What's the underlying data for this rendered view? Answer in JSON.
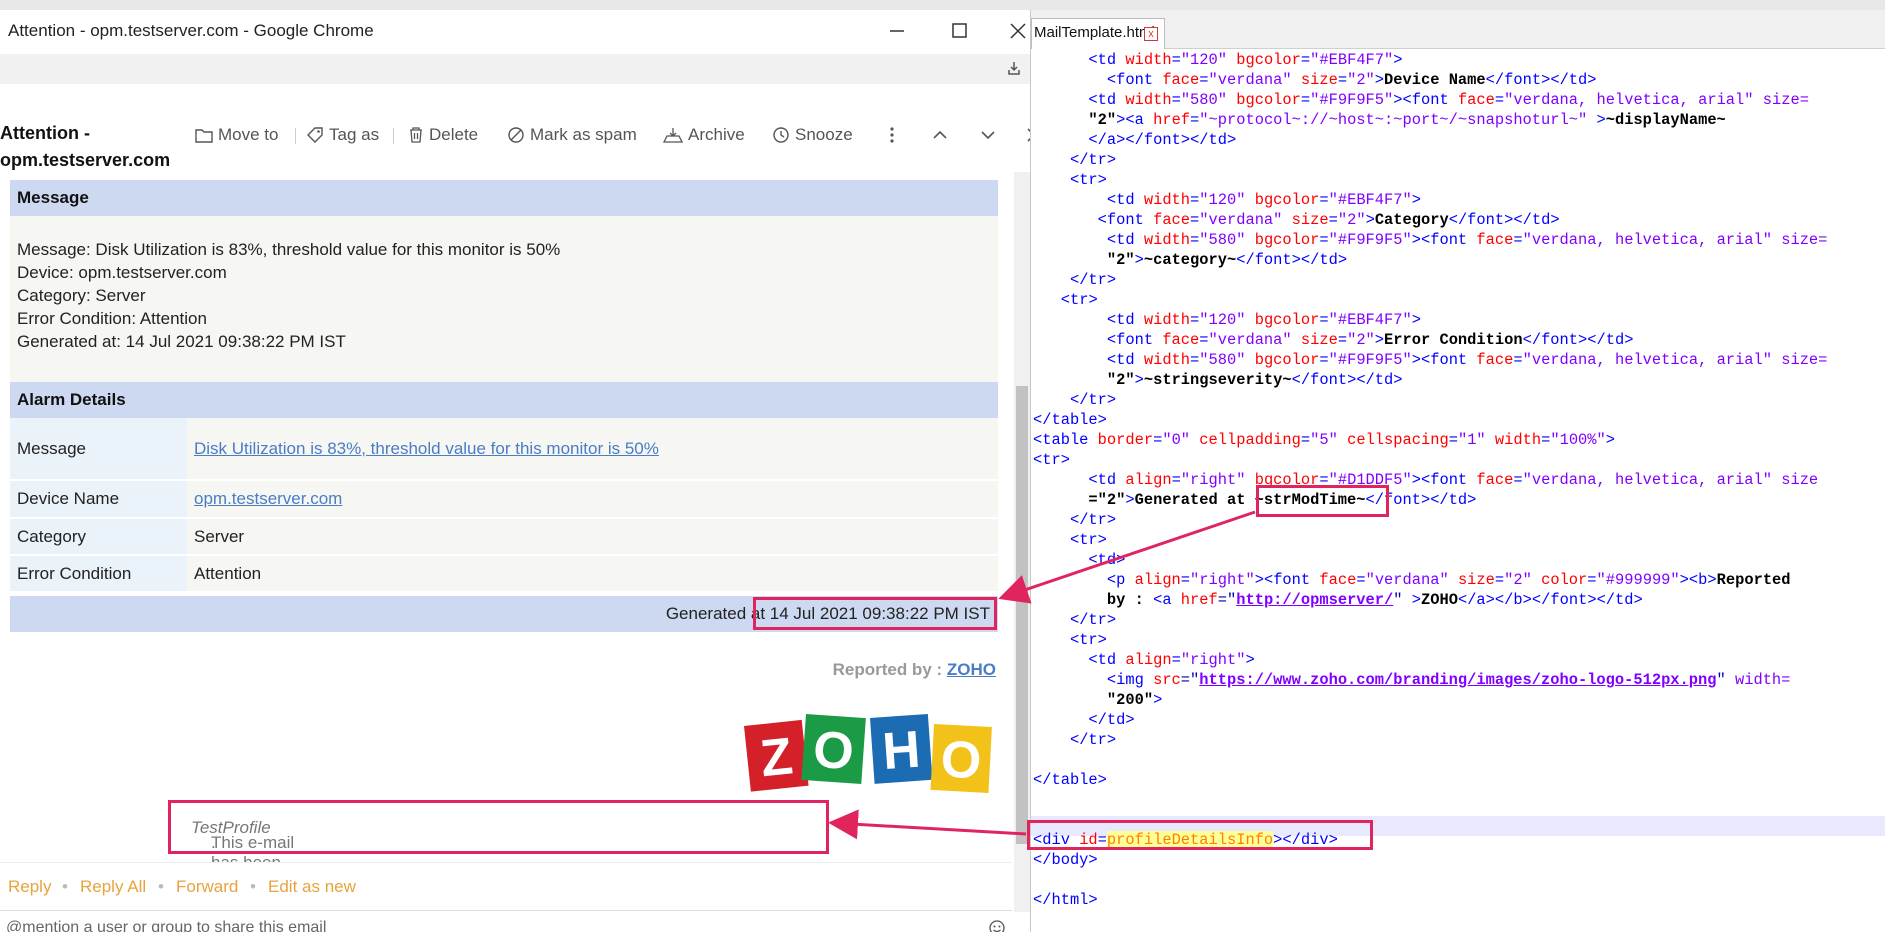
{
  "browser": {
    "window_title": "Attention - opm.testserver.com - Google Chrome"
  },
  "mail": {
    "subject": "Attention - opm.testserver.com",
    "toolbar": {
      "move_to": "Move to",
      "tag_as": "Tag as",
      "delete": "Delete",
      "mark_as_spam": "Mark as spam",
      "archive": "Archive",
      "snooze": "Snooze"
    },
    "message_header": "Message",
    "message_lines": [
      "Message: Disk Utilization is 83%, threshold value for this monitor is 50%",
      "Device: opm.testserver.com",
      "Category: Server",
      "Error Condition: Attention",
      "Generated at: 14 Jul 2021 09:38:22 PM IST"
    ],
    "alarm_details_header": "Alarm Details",
    "alarm_rows": [
      {
        "key": "Message",
        "value": "Disk Utilization is 83%, threshold value for this monitor is 50%",
        "link": true
      },
      {
        "key": "Device Name",
        "value": "opm.testserver.com",
        "link": true
      },
      {
        "key": "Category",
        "value": "Server",
        "link": false
      },
      {
        "key": "Error Condition",
        "value": "Attention",
        "link": false
      }
    ],
    "generated_label": "Generated at ",
    "generated_value": "14 Jul 2021 09:38:22 PM IST",
    "reported_by_label": "Reported by : ",
    "reported_by_link": "ZOHO",
    "logo_letters": [
      "Z",
      "O",
      "H",
      "O"
    ],
    "profile_note": "This e-mail has been generated by the Notification Profile named ",
    "profile_name": "TestProfile",
    "profile_note_end": ".",
    "actions": {
      "reply": "Reply",
      "reply_all": "Reply All",
      "forward": "Forward",
      "edit_as_new": "Edit as new",
      "separator": "•"
    },
    "mention_placeholder": "@mention a user or group to share this email"
  },
  "editor": {
    "tab_name": "MailTemplate.html",
    "tab_close": "x",
    "code_lines": [
      "      <td width=\"120\" bgcolor=\"#EBF4F7\">",
      "        <font face=\"verdana\" size=\"2\">Device Name</font></td>",
      "      <td width=\"580\" bgcolor=\"#F9F9F5\"><font face=\"verdana, helvetica, arial\" size=",
      "      \"2\"><a href=\"~protocol~://~host~:~port~/~snapshoturl~\" >~displayName~",
      "      </a></font></td>",
      "    </tr>",
      "    <tr>",
      "        <td width=\"120\" bgcolor=\"#EBF4F7\">",
      "       <font face=\"verdana\" size=\"2\">Category</font></td>",
      "        <td width=\"580\" bgcolor=\"#F9F9F5\"><font face=\"verdana, helvetica, arial\" size=",
      "        \"2\">~category~</font></td>",
      "    </tr>",
      "   <tr>",
      "        <td width=\"120\" bgcolor=\"#EBF4F7\">",
      "        <font face=\"verdana\" size=\"2\">Error Condition</font></td>",
      "        <td width=\"580\" bgcolor=\"#F9F9F5\"><font face=\"verdana, helvetica, arial\" size=",
      "        \"2\">~stringseverity~</font></td>",
      "    </tr>",
      "</table>",
      "<table border=\"0\" cellpadding=\"5\" cellspacing=\"1\" width=\"100%\">",
      "<tr>",
      "      <td align=\"right\" bgcolor=\"#D1DDF5\"><font face=\"verdana, helvetica, arial\" size",
      "      =\"2\">Generated at ~strModTime~</font></td>",
      "    </tr>",
      "    <tr>",
      "      <td>",
      "        <p align=\"right\"><font face=\"verdana\" size=\"2\" color=\"#999999\"><b>Reported",
      "        by : <a href=\"http://opmserver/\" >ZOHO</a></b></font></td>",
      "    </tr>",
      "    <tr>",
      "      <td align=\"right\">",
      "        <img src=\"https://www.zoho.com/branding/images/zoho-logo-512px.png\" width=",
      "        \"200\">",
      "      </td>",
      "    </tr>",
      "",
      "</table>",
      "",
      "",
      "<div id=profileDetailsInfo></div>",
      "</body>",
      "",
      "</html>"
    ]
  },
  "colors": {
    "highlight_box": "#e0245e",
    "section_header_bg": "#cdd9f0",
    "link": "#4a7cc7",
    "action_link": "#e8a33d"
  }
}
